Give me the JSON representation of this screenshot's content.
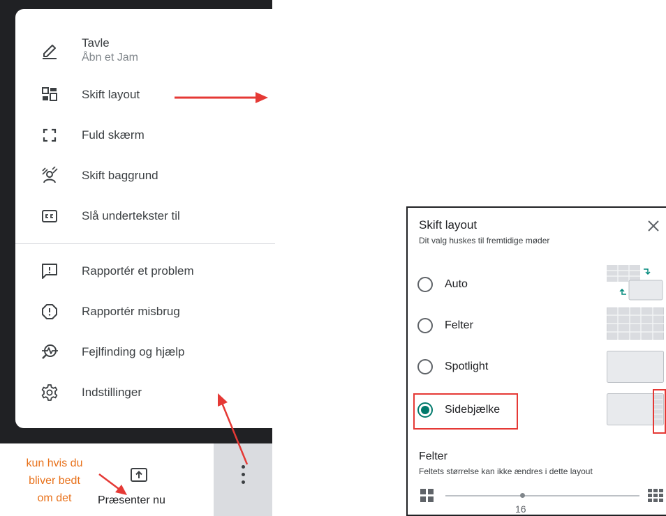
{
  "menu": {
    "items": [
      {
        "icon": "pencil-icon",
        "label": "Tavle",
        "sublabel": "Åbn et Jam"
      },
      {
        "icon": "layout-icon",
        "label": "Skift layout"
      },
      {
        "icon": "fullscreen-icon",
        "label": "Fuld skærm"
      },
      {
        "icon": "background-person-icon",
        "label": "Skift baggrund"
      },
      {
        "icon": "closed-captions-icon",
        "label": "Slå undertekster til"
      },
      {
        "icon": "feedback-icon",
        "label": "Rapportér et problem"
      },
      {
        "icon": "report-icon",
        "label": "Rapportér misbrug"
      },
      {
        "icon": "troubleshoot-icon",
        "label": "Fejlfinding og hjælp"
      },
      {
        "icon": "gear-icon",
        "label": "Indstillinger"
      }
    ]
  },
  "bottom_bar": {
    "present_label": "Præsenter nu",
    "more_icon": "more-vert-icon"
  },
  "annotation": {
    "note_lines": [
      "kun hvis du",
      "bliver bedt",
      "om det"
    ],
    "color": "#e8711a",
    "arrow_color": "#e53935"
  },
  "dialog": {
    "title": "Skift layout",
    "subtitle": "Dit valg huskes til fremtidige møder",
    "options": [
      {
        "label": "Auto",
        "selected": false
      },
      {
        "label": "Felter",
        "selected": false
      },
      {
        "label": "Spotlight",
        "selected": false
      },
      {
        "label": "Sidebjælke",
        "selected": true
      }
    ],
    "tiles_title": "Felter",
    "tiles_subtitle": "Feltets størrelse kan ikke ændres i dette layout",
    "slider_value": "16",
    "accent": "#00796b"
  }
}
